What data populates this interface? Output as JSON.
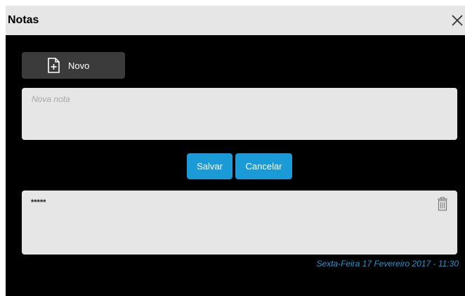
{
  "window": {
    "title": "Notas"
  },
  "toolbar": {
    "new_label": "Novo"
  },
  "editor": {
    "placeholder": "Nova nota",
    "value": ""
  },
  "actions": {
    "save_label": "Salvar",
    "cancel_label": "Cancelar"
  },
  "notes": [
    {
      "text": "*****",
      "timestamp": "Sexta-Feira 17 Fevereiro 2017 - 11:30"
    }
  ],
  "icons": {
    "close": "close-icon",
    "new": "file-plus-icon",
    "delete": "trash-icon"
  },
  "colors": {
    "background": "#000000",
    "panel": "#e6e6e6",
    "accent": "#1a9ad6",
    "new_button": "#3b3b3b"
  }
}
